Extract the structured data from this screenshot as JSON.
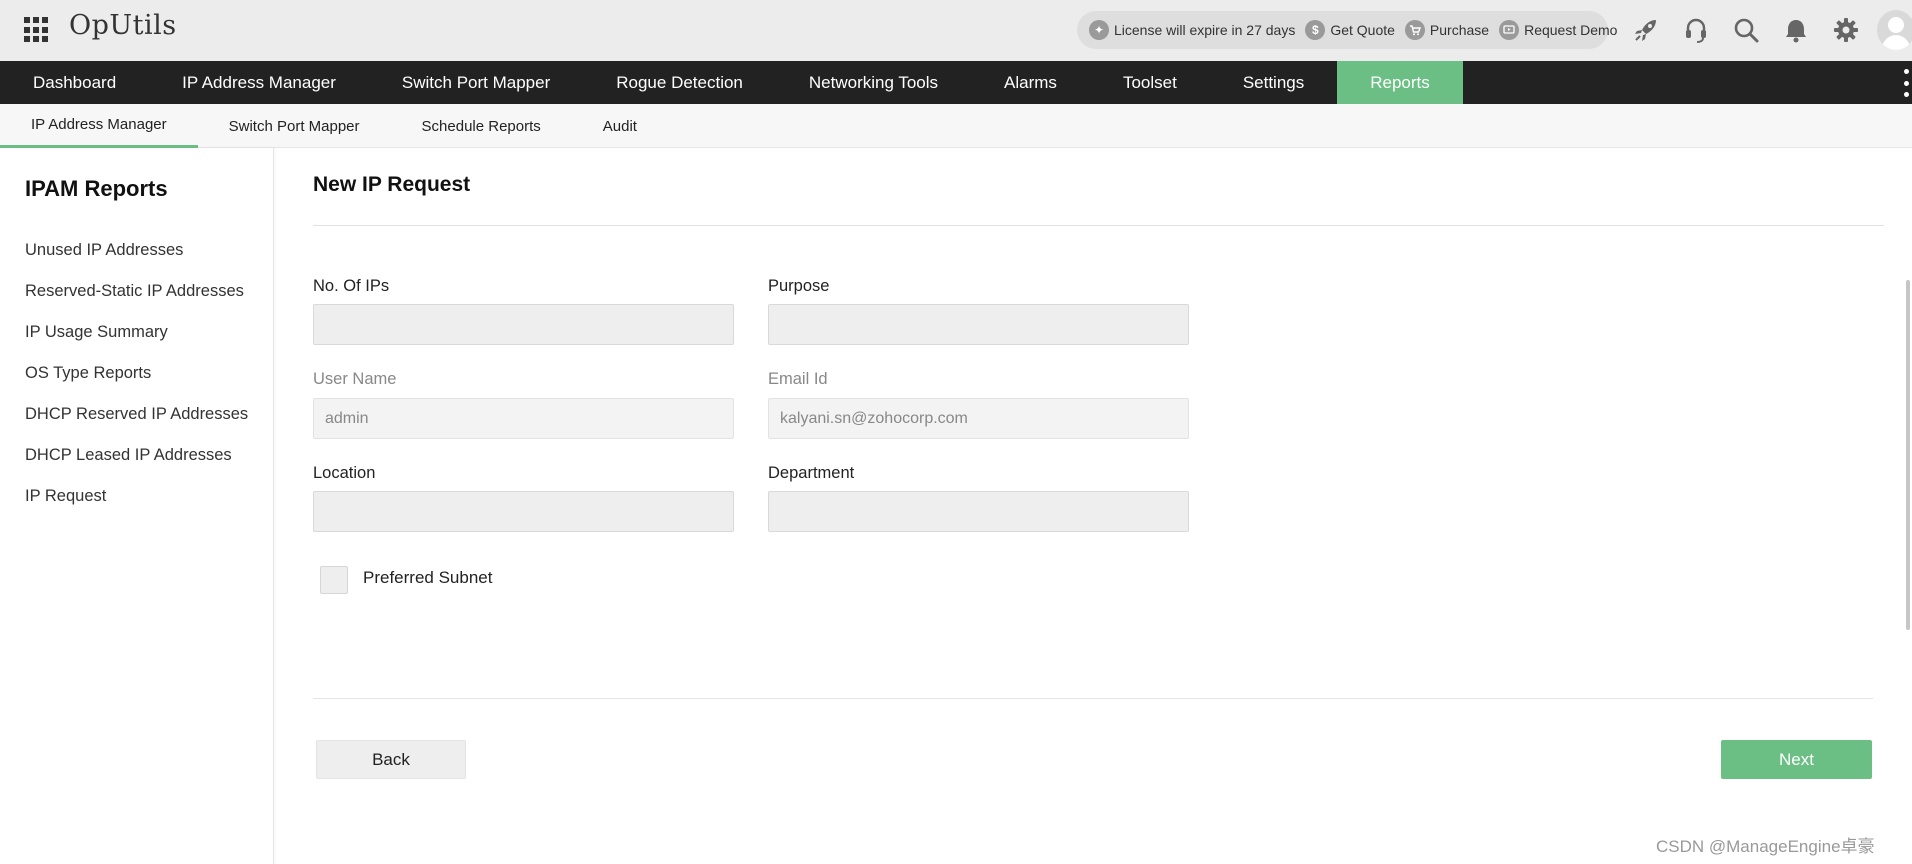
{
  "app": {
    "title": "OpUtils"
  },
  "header": {
    "license_text": "License will expire in 27 days",
    "get_quote": "Get Quote",
    "purchase": "Purchase",
    "request_demo": "Request Demo"
  },
  "mainnav": {
    "items": [
      {
        "label": "Dashboard"
      },
      {
        "label": "IP Address Manager"
      },
      {
        "label": "Switch Port Mapper"
      },
      {
        "label": "Rogue Detection"
      },
      {
        "label": "Networking Tools"
      },
      {
        "label": "Alarms"
      },
      {
        "label": "Toolset"
      },
      {
        "label": "Settings"
      },
      {
        "label": "Reports",
        "active": true
      }
    ]
  },
  "subnav": {
    "items": [
      {
        "label": "IP Address Manager",
        "active": true
      },
      {
        "label": "Switch Port Mapper"
      },
      {
        "label": "Schedule Reports"
      },
      {
        "label": "Audit"
      }
    ]
  },
  "sidebar": {
    "title": "IPAM Reports",
    "items": [
      {
        "label": "Unused IP Addresses"
      },
      {
        "label": "Reserved-Static IP Addresses"
      },
      {
        "label": "IP Usage Summary"
      },
      {
        "label": "OS Type Reports"
      },
      {
        "label": "DHCP Reserved IP Addresses"
      },
      {
        "label": "DHCP Leased IP Addresses"
      },
      {
        "label": "IP Request"
      }
    ]
  },
  "form": {
    "title": "New IP Request",
    "no_of_ips": {
      "label": "No. Of IPs",
      "value": ""
    },
    "purpose": {
      "label": "Purpose",
      "value": ""
    },
    "user_name": {
      "label": "User Name",
      "value": "admin"
    },
    "email_id": {
      "label": "Email Id",
      "value": "kalyani.sn@zohocorp.com"
    },
    "location": {
      "label": "Location",
      "value": ""
    },
    "department": {
      "label": "Department",
      "value": ""
    },
    "preferred_subnet": {
      "label": "Preferred Subnet",
      "checked": false
    },
    "back_label": "Back",
    "next_label": "Next"
  },
  "watermark": "CSDN @ManageEngine卓豪",
  "colors": {
    "accent": "#6cbf84",
    "nav_bg": "#222222",
    "header_bg": "#ececec"
  },
  "icons": [
    "apps-grid-icon",
    "license-icon",
    "dollar-icon",
    "cart-icon",
    "demo-icon",
    "rocket-icon",
    "headset-icon",
    "search-icon",
    "bell-icon",
    "gear-icon",
    "user-avatar-icon",
    "more-vertical-icon"
  ]
}
